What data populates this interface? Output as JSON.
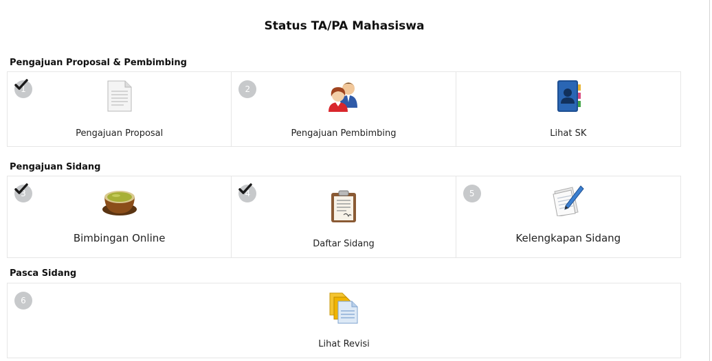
{
  "page": {
    "title": "Status TA/PA Mahasiswa"
  },
  "sections": [
    {
      "title": "Pengajuan Proposal & Pembimbing",
      "cards": [
        {
          "step": "1",
          "label": "Pengajuan Proposal",
          "icon": "document-icon",
          "completed": true
        },
        {
          "step": "2",
          "label": "Pengajuan Pembimbing",
          "icon": "people-icon",
          "completed": false
        },
        {
          "step": "",
          "label": "Lihat SK",
          "icon": "contact-book-icon",
          "completed": false
        }
      ]
    },
    {
      "title": "Pengajuan Sidang",
      "cards": [
        {
          "step": "3",
          "label": "Bimbingan Online",
          "icon": "tea-bowl-icon",
          "completed": true
        },
        {
          "step": "4",
          "label": "Daftar Sidang",
          "icon": "clipboard-icon",
          "completed": true
        },
        {
          "step": "5",
          "label": "Kelengkapan Sidang",
          "icon": "writing-paper-icon",
          "completed": false
        }
      ]
    },
    {
      "title": "Pasca Sidang",
      "cards": [
        {
          "step": "6",
          "label": "Lihat Revisi",
          "icon": "files-icon",
          "completed": false
        }
      ]
    }
  ],
  "colors": {
    "badge": "#c7c9cb",
    "border": "#e6e6e6",
    "check": "#1a1a1a"
  }
}
